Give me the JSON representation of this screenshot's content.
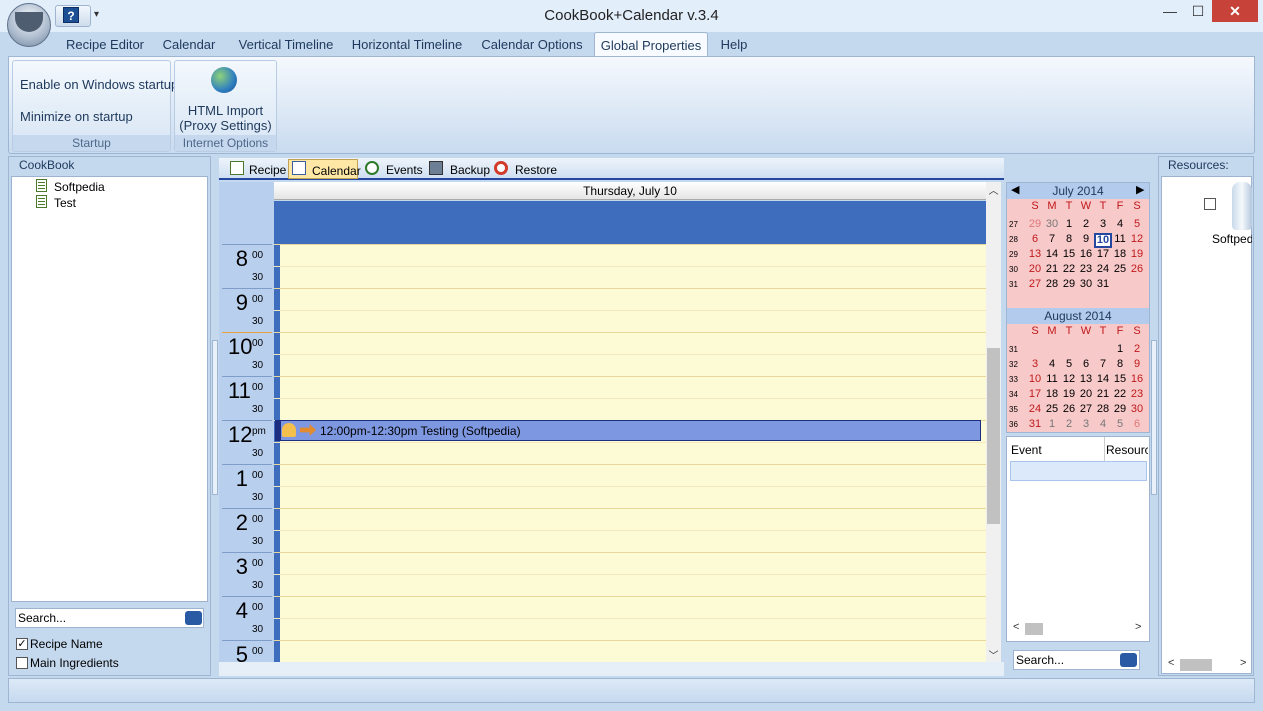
{
  "window": {
    "title": "CookBook+Calendar v.3.4",
    "min": "—",
    "max": "☐",
    "close": "✕",
    "help": "?",
    "qat_dropdown": "▾"
  },
  "ribbon_tabs": [
    {
      "label": "Recipe Editor"
    },
    {
      "label": "Calendar"
    },
    {
      "label": "Vertical Timeline"
    },
    {
      "label": "Horizontal Timeline"
    },
    {
      "label": "Calendar Options"
    },
    {
      "label": "Global Properties",
      "active": true
    },
    {
      "label": "Help"
    }
  ],
  "ribbon": {
    "startup": {
      "enable_label": "Enable on Windows startup",
      "minimize_label": "Minimize on startup",
      "group_label": "Startup"
    },
    "internet": {
      "html_import_line1": "HTML Import",
      "html_import_line2": "(Proxy Settings)",
      "group_label": "Internet Options"
    }
  },
  "left_panel": {
    "title": "CookBook",
    "tree": [
      {
        "label": "Softpedia"
      },
      {
        "label": "Test"
      }
    ],
    "search_placeholder": "Search...",
    "options": [
      {
        "label": "Recipe Name",
        "checked": true
      },
      {
        "label": "Main Ingredients",
        "checked": false
      }
    ]
  },
  "view_tabs": [
    {
      "label": "Recipe"
    },
    {
      "label": "Calendar",
      "active": true
    },
    {
      "label": "Events"
    },
    {
      "label": "Backup"
    },
    {
      "label": "Restore"
    }
  ],
  "day_view": {
    "header": "Thursday, July 10",
    "hours": [
      {
        "h": "8",
        "m": "00"
      },
      {
        "h": "9",
        "m": "00"
      },
      {
        "h": "10",
        "m": "00"
      },
      {
        "h": "11",
        "m": "00"
      },
      {
        "h": "12",
        "m": "pm"
      },
      {
        "h": "1",
        "m": "00"
      },
      {
        "h": "2",
        "m": "00"
      },
      {
        "h": "3",
        "m": "00"
      },
      {
        "h": "4",
        "m": "00"
      },
      {
        "h": "5",
        "m": "00"
      }
    ],
    "half": "30",
    "event": "12:00pm-12:30pm Testing (Softpedia)"
  },
  "mini_cal": {
    "july": {
      "title": "July 2014",
      "day_names": [
        "S",
        "M",
        "T",
        "W",
        "T",
        "F",
        "S"
      ],
      "weeks": [
        {
          "wk": "27",
          "days": [
            "29",
            "30",
            "1",
            "2",
            "3",
            "4",
            "5"
          ]
        },
        {
          "wk": "28",
          "days": [
            "6",
            "7",
            "8",
            "9",
            "10",
            "11",
            "12"
          ]
        },
        {
          "wk": "29",
          "days": [
            "13",
            "14",
            "15",
            "16",
            "17",
            "18",
            "19"
          ]
        },
        {
          "wk": "30",
          "days": [
            "20",
            "21",
            "22",
            "23",
            "24",
            "25",
            "26"
          ]
        },
        {
          "wk": "31",
          "days": [
            "27",
            "28",
            "29",
            "30",
            "31",
            "",
            ""
          ]
        }
      ],
      "selected": "10"
    },
    "august": {
      "title": "August 2014",
      "weeks": [
        {
          "wk": "31",
          "days": [
            "",
            "",
            "",
            "",
            "",
            "1",
            "2"
          ]
        },
        {
          "wk": "32",
          "days": [
            "3",
            "4",
            "5",
            "6",
            "7",
            "8",
            "9"
          ]
        },
        {
          "wk": "33",
          "days": [
            "10",
            "11",
            "12",
            "13",
            "14",
            "15",
            "16"
          ]
        },
        {
          "wk": "34",
          "days": [
            "17",
            "18",
            "19",
            "20",
            "21",
            "22",
            "23"
          ]
        },
        {
          "wk": "35",
          "days": [
            "24",
            "25",
            "26",
            "27",
            "28",
            "29",
            "30"
          ]
        },
        {
          "wk": "36",
          "days": [
            "31",
            "1",
            "2",
            "3",
            "4",
            "5",
            "6"
          ]
        }
      ]
    },
    "prev": "◀",
    "next": "▶"
  },
  "event_list": {
    "columns": [
      "Event",
      "Resource"
    ],
    "search_placeholder": "Search..."
  },
  "resources": {
    "title": "Resources:",
    "item": "Softped"
  },
  "colors": {
    "accent": "#2448a0",
    "event": "#7d97e0",
    "grid": "#fdfbd6",
    "weekend": "#c0191b"
  }
}
